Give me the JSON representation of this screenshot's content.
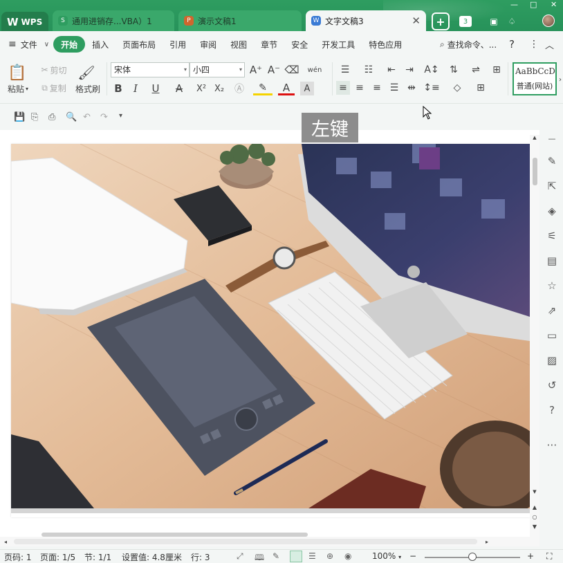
{
  "tabs": {
    "wps": "WPS",
    "sheet": "通用进销存...VBA）1",
    "slides": "演示文稿1",
    "doc": "文字文稿3",
    "doc_close": "✕",
    "sheet_badge": "S",
    "slides_badge": "P",
    "doc_badge": "W",
    "sheet_badge_color": "#2e9d60",
    "slides_badge_color": "#d0662e",
    "doc_badge_color": "#3a7bd5",
    "window_count": "3"
  },
  "menu": {
    "file": "文件",
    "items": [
      "开始",
      "插入",
      "页面布局",
      "引用",
      "审阅",
      "视图",
      "章节",
      "安全",
      "开发工具",
      "特色应用"
    ],
    "search": "查找命令、...",
    "help": "?",
    "more": "⋮",
    "collapse": "︿"
  },
  "ribbon": {
    "paste": "粘贴",
    "cut": "剪切",
    "copy": "复制",
    "format_painter": "格式刷",
    "font_name": "宋体",
    "font_size": "小四",
    "style_preview": "AaBbCcDd",
    "style_name": "普通(网站)",
    "bold": "B",
    "italic": "I",
    "underline": "U",
    "strike": "A",
    "superscript": "X²",
    "subscript": "X₂",
    "font_color_label": "A",
    "grow": "A⁺",
    "shrink": "A⁻",
    "phonetic": "wén"
  },
  "tooltip": "左键",
  "status": {
    "page_code": "页码: 1",
    "page": "页面: 1/5",
    "section": "节: 1/1",
    "setting": "设置值: 4.8厘米",
    "row": "行: 3",
    "zoom": "100%",
    "zoom_out": "−",
    "zoom_in": "+"
  },
  "colors": {
    "accent": "#2e9d60",
    "titlebar": "#2e9d60"
  }
}
